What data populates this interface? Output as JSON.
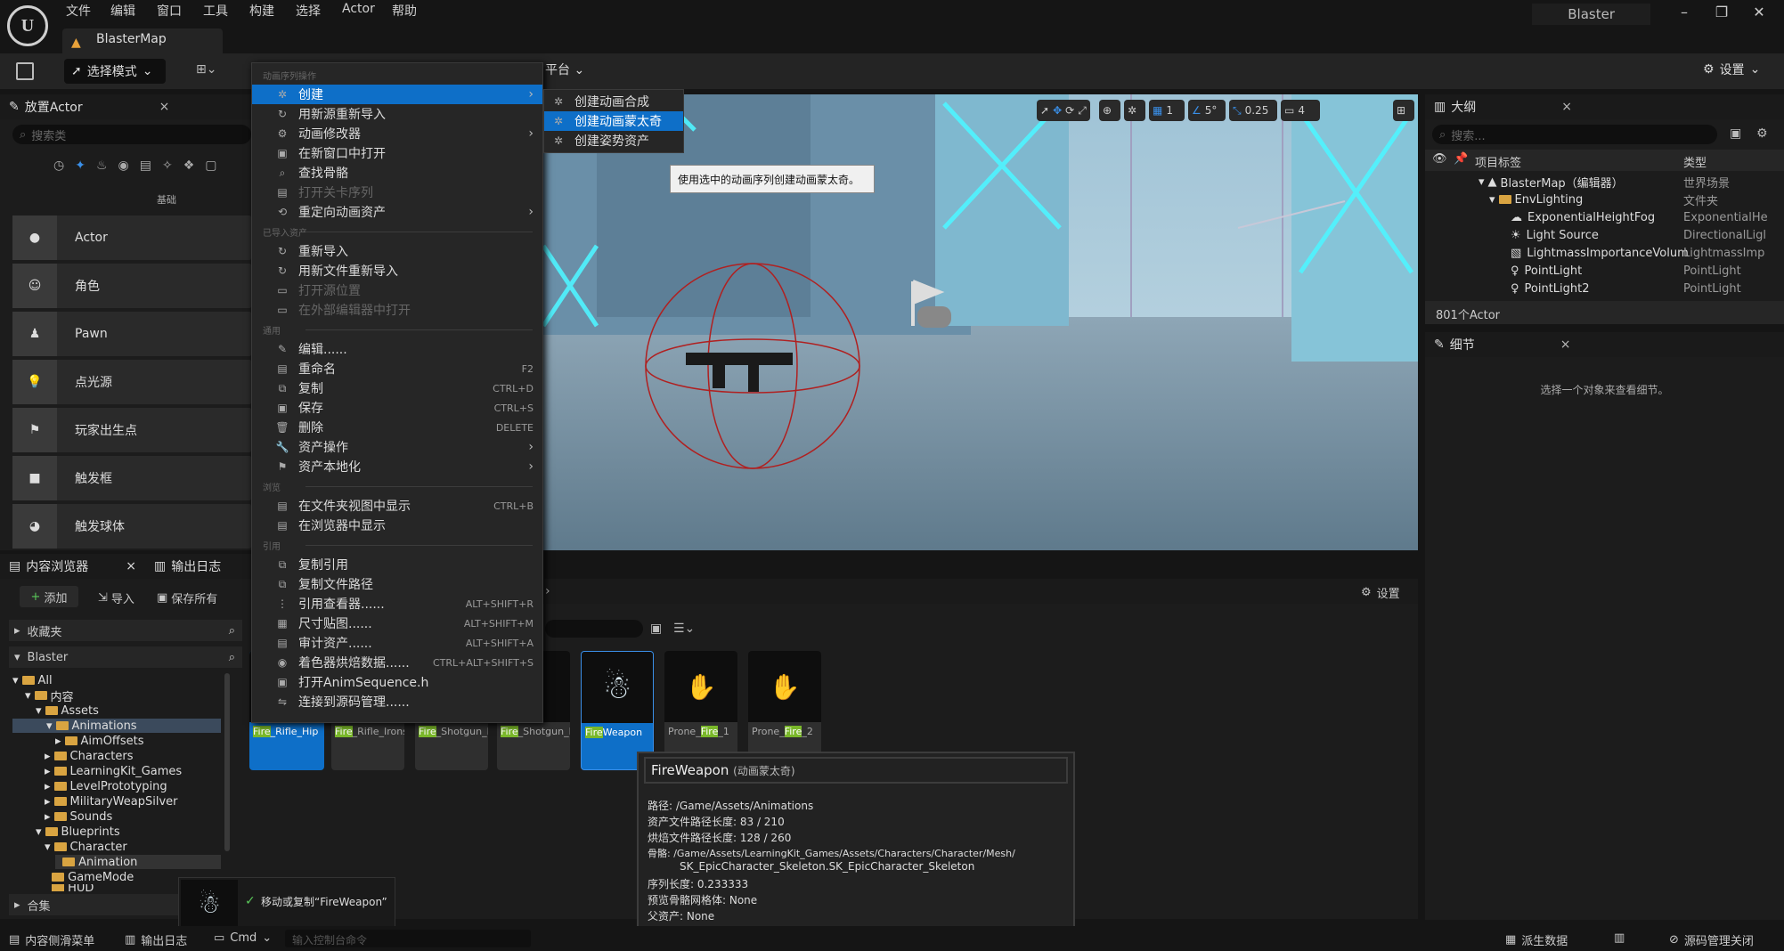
{
  "app": {
    "title": "Blaster",
    "map_tab": "BlasterMap"
  },
  "menubar": [
    "文件",
    "编辑",
    "窗口",
    "工具",
    "构建",
    "选择",
    "Actor",
    "帮助"
  ],
  "toolbar": {
    "mode": "选择模式",
    "platform": "平台",
    "settings": "设置"
  },
  "place_actor": {
    "tab": "放置Actor",
    "search_placeholder": "搜索类",
    "category": "基础",
    "items": [
      "Actor",
      "角色",
      "Pawn",
      "点光源",
      "玩家出生点",
      "触发框",
      "触发球体"
    ]
  },
  "context_menu": {
    "sections": {
      "anim": "动画序列操作",
      "imported": "已导入资产",
      "common": "通用",
      "explore": "浏览",
      "refs": "引用"
    },
    "items": [
      {
        "label": "创建",
        "sub": true,
        "selected": true
      },
      {
        "label": "用新源重新导入"
      },
      {
        "label": "动画修改器",
        "sub": true
      },
      {
        "label": "在新窗口中打开"
      },
      {
        "label": "查找骨骼"
      },
      {
        "label": "打开关卡序列",
        "disabled": true
      },
      {
        "label": "重定向动画资产",
        "sub": true
      },
      {
        "label": "重新导入"
      },
      {
        "label": "用新文件重新导入"
      },
      {
        "label": "打开源位置",
        "disabled": true
      },
      {
        "label": "在外部编辑器中打开",
        "disabled": true
      },
      {
        "label": "编辑......"
      },
      {
        "label": "重命名",
        "shortcut": "F2"
      },
      {
        "label": "复制",
        "shortcut": "CTRL+D"
      },
      {
        "label": "保存",
        "shortcut": "CTRL+S"
      },
      {
        "label": "删除",
        "shortcut": "DELETE"
      },
      {
        "label": "资产操作",
        "sub": true
      },
      {
        "label": "资产本地化",
        "sub": true
      },
      {
        "label": "在文件夹视图中显示",
        "shortcut": "CTRL+B"
      },
      {
        "label": "在浏览器中显示"
      },
      {
        "label": "复制引用"
      },
      {
        "label": "复制文件路径"
      },
      {
        "label": "引用查看器......",
        "shortcut": "ALT+SHIFT+R"
      },
      {
        "label": "尺寸贴图......",
        "shortcut": "ALT+SHIFT+M"
      },
      {
        "label": "审计资产......",
        "shortcut": "ALT+SHIFT+A"
      },
      {
        "label": "着色器烘焙数据......",
        "shortcut": "CTRL+ALT+SHIFT+S"
      },
      {
        "label": "打开AnimSequence.h"
      },
      {
        "label": "连接到源码管理......"
      }
    ]
  },
  "submenu": {
    "items": [
      "创建动画合成",
      "创建动画蒙太奇",
      "创建姿势资产"
    ],
    "tooltip": "使用选中的动画序列创建动画蒙太奇。"
  },
  "viewport": {
    "snap_angle": "5°",
    "snap_scale": "0.25",
    "grid": "1",
    "camera_speed": "4"
  },
  "outliner": {
    "tab": "大纲",
    "search_placeholder": "搜索...",
    "col_label": "项目标签",
    "col_type": "类型",
    "rows": [
      {
        "label": "BlasterMap（编辑器）",
        "type": "世界场景"
      },
      {
        "label": "EnvLighting",
        "type": "文件夹"
      },
      {
        "label": "ExponentialHeightFog",
        "type": "ExponentialHe"
      },
      {
        "label": "Light Source",
        "type": "DirectionalLigl"
      },
      {
        "label": "LightmassImportanceVolum",
        "type": "LightmassImp"
      },
      {
        "label": "PointLight",
        "type": "PointLight"
      },
      {
        "label": "PointLight2",
        "type": "PointLight"
      }
    ],
    "count": "801个Actor"
  },
  "details": {
    "tab": "细节",
    "empty": "选择一个对象来查看细节。"
  },
  "content_browser": {
    "tab": "内容浏览器",
    "tab2": "输出日志",
    "add": "添加",
    "import": "导入",
    "save_all": "保存所有",
    "favorites": "收藏夹",
    "project": "Blaster",
    "collections": "合集",
    "settings": "设置",
    "tree": [
      "All",
      "内容",
      "Assets",
      "Animations",
      "AimOffsets",
      "Characters",
      "LearningKit_Games",
      "LevelPrototyping",
      "MilitaryWeapSilver",
      "Sounds",
      "Blueprints",
      "Character",
      "Animation",
      "GameMode",
      "HUD"
    ]
  },
  "assets": [
    {
      "hl": "Fire",
      "rest": "_Rifle_Hip"
    },
    {
      "hl": "Fire",
      "rest": "_Rifle_Ironsights"
    },
    {
      "hl": "Fire",
      "rest": "_Shotgun_Hip"
    },
    {
      "hl": "Fire",
      "rest": "_Shotgun_Ironsights"
    },
    {
      "hl": "Fire",
      "rest": "Weapon"
    },
    {
      "pre": "Prone_",
      "hl": "Fire",
      "rest": "_1"
    },
    {
      "pre": "Prone_",
      "hl": "Fire",
      "rest": "_2"
    }
  ],
  "asset_tooltip": {
    "name": "FireWeapon",
    "kind": "(动画蒙太奇)",
    "rows": [
      "路径: /Game/Assets/Animations",
      "资产文件路径长度: 83 / 210",
      "烘焙文件路径长度: 128 / 260",
      "骨骼: /Game/Assets/LearningKit_Games/Assets/Characters/Character/Mesh/",
      "SK_EpicCharacter_Skeleton.SK_EpicCharacter_Skeleton",
      "序列长度: 0.233333",
      "预览骨骼网格体: None",
      "父资产: None"
    ]
  },
  "drag_note": "移动或复制“FireWeapon”",
  "statusbar": {
    "drawer": "内容侧滑菜单",
    "log": "输出日志",
    "cmd": "Cmd",
    "console_placeholder": "输入控制台命令",
    "derived": "派生数据",
    "scm": "源码管理关闭"
  }
}
